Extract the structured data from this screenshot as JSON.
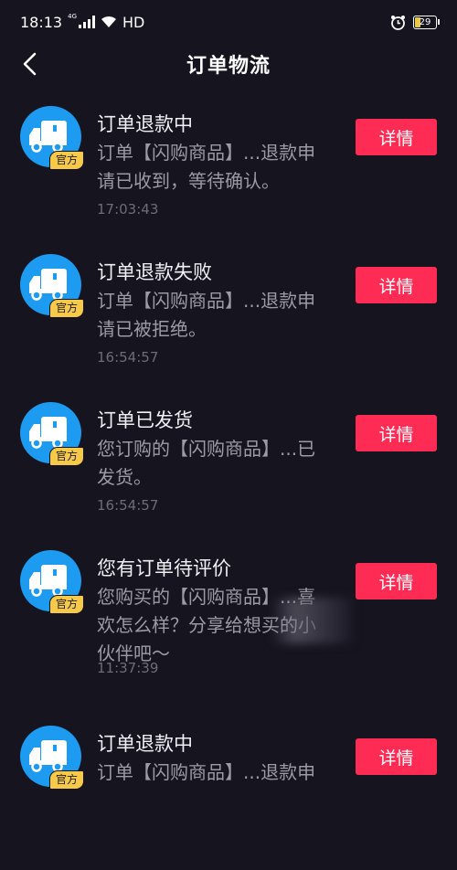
{
  "status_bar": {
    "time": "18:13",
    "network": "4G",
    "hd": "HD",
    "battery": "29"
  },
  "header": {
    "title": "订单物流"
  },
  "colors": {
    "background": "#15141f",
    "accent": "#fe2c55",
    "avatar": "#1d9bf0",
    "badge": "#f7c948"
  },
  "notifications": [
    {
      "title": "订单退款中",
      "desc": "订单【闪购商品】...退款申请已收到，等待确认。",
      "time": "17:03:43",
      "badge": "官方",
      "button": "详情",
      "icon": "delivery-truck-icon"
    },
    {
      "title": "订单退款失败",
      "desc": "订单【闪购商品】...退款申请已被拒绝。",
      "time": "16:54:57",
      "badge": "官方",
      "button": "详情",
      "icon": "delivery-truck-icon"
    },
    {
      "title": "订单已发货",
      "desc": "您订购的【闪购商品】...已发货。",
      "time": "16:54:57",
      "badge": "官方",
      "button": "详情",
      "icon": "delivery-truck-icon"
    },
    {
      "title": "您有订单待评价",
      "desc": "您购买的【闪购商品】...喜欢怎么样？分享给想买的小伙伴吧～",
      "time": "11:37:39",
      "badge": "官方",
      "button": "详情",
      "icon": "delivery-truck-icon"
    },
    {
      "title": "订单退款中",
      "desc": "订单【闪购商品】...退款申",
      "time": "",
      "badge": "官方",
      "button": "详情",
      "icon": "delivery-truck-icon"
    }
  ]
}
